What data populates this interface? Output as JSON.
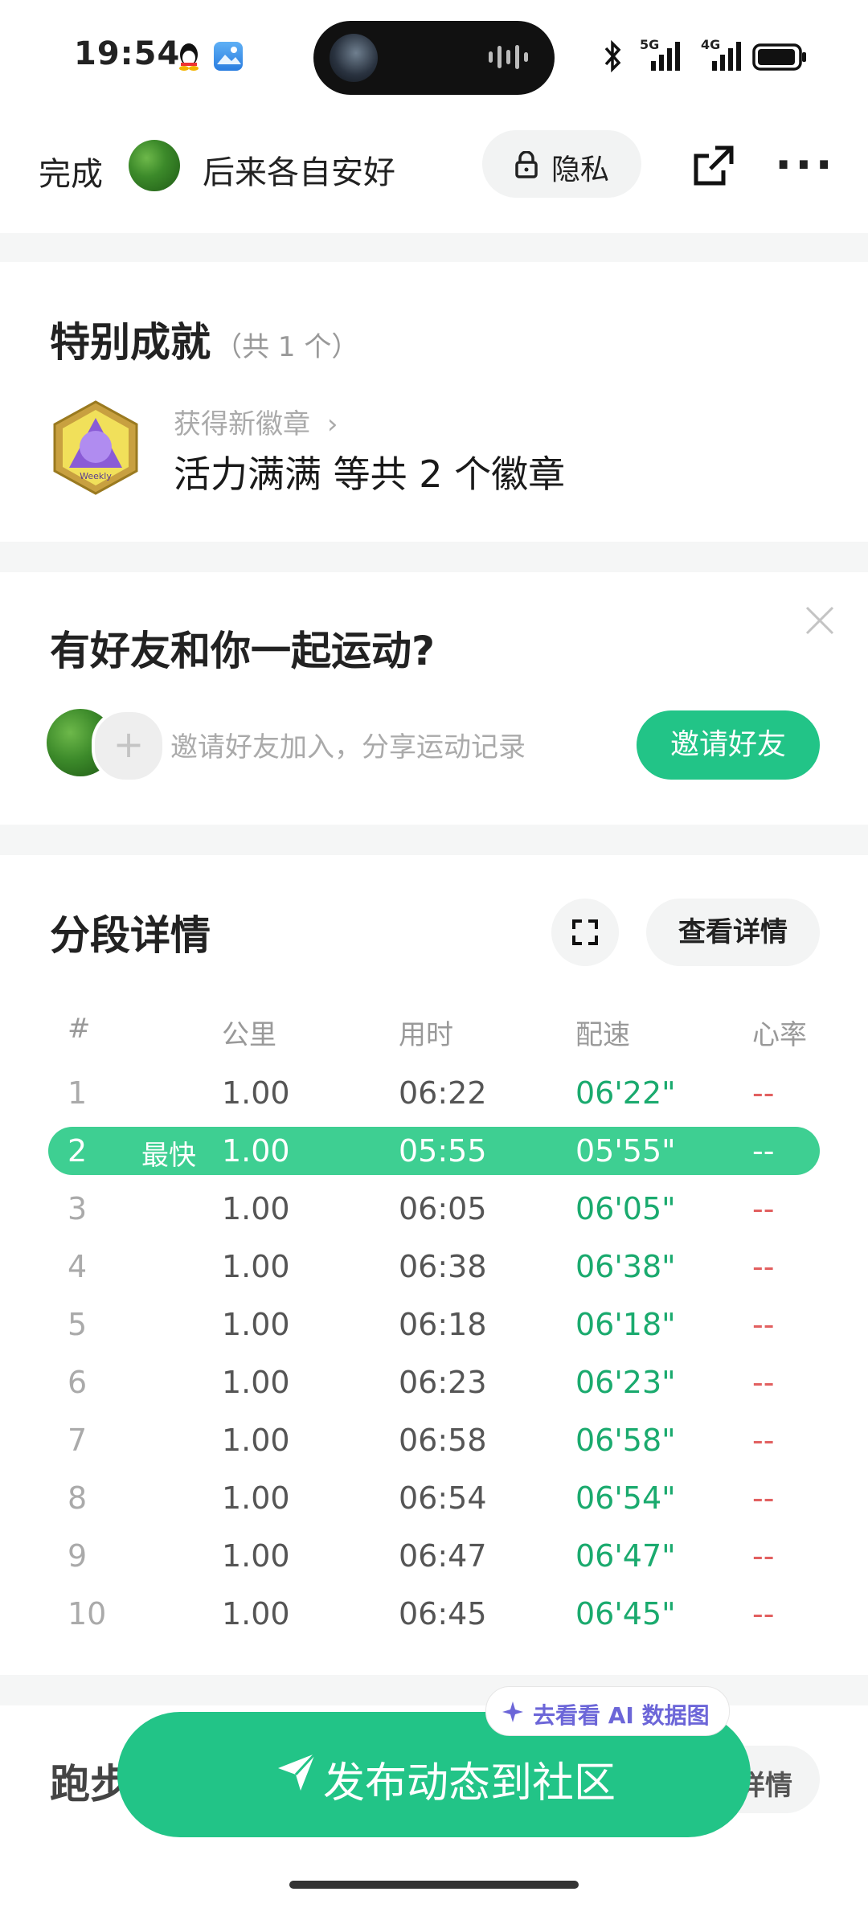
{
  "status_bar": {
    "time": "19:54",
    "net1": "5G",
    "net2": "4G"
  },
  "header": {
    "done_label": "完成",
    "user_name": "后来各自安好",
    "privacy_label": "隐私"
  },
  "achievements": {
    "title": "特别成就",
    "count_label": "（共 1 个）",
    "new_badge_label": "获得新徽章",
    "badge_summary": "活力满满 等共 2 个徽章",
    "badge_inner_text": "Weekly"
  },
  "friends": {
    "title": "有好友和你一起运动?",
    "hint": "邀请好友加入，分享运动记录",
    "invite_button": "邀请好友"
  },
  "splits": {
    "title": "分段详情",
    "view_details_button": "查看详情",
    "columns": [
      "#",
      "公里",
      "用时",
      "配速",
      "心率"
    ],
    "fastest_tag": "最快",
    "rows": [
      {
        "idx": "1",
        "km": "1.00",
        "time": "06:22",
        "pace": "06'22\"",
        "hr": "--"
      },
      {
        "idx": "2",
        "km": "1.00",
        "time": "05:55",
        "pace": "05'55\"",
        "hr": "--"
      },
      {
        "idx": "3",
        "km": "1.00",
        "time": "06:05",
        "pace": "06'05\"",
        "hr": "--"
      },
      {
        "idx": "4",
        "km": "1.00",
        "time": "06:38",
        "pace": "06'38\"",
        "hr": "--"
      },
      {
        "idx": "5",
        "km": "1.00",
        "time": "06:18",
        "pace": "06'18\"",
        "hr": "--"
      },
      {
        "idx": "6",
        "km": "1.00",
        "time": "06:23",
        "pace": "06'23\"",
        "hr": "--"
      },
      {
        "idx": "7",
        "km": "1.00",
        "time": "06:58",
        "pace": "06'58\"",
        "hr": "--"
      },
      {
        "idx": "8",
        "km": "1.00",
        "time": "06:54",
        "pace": "06'54\"",
        "hr": "--"
      },
      {
        "idx": "9",
        "km": "1.00",
        "time": "06:47",
        "pace": "06'47\"",
        "hr": "--"
      },
      {
        "idx": "10",
        "km": "1.00",
        "time": "06:45",
        "pace": "06'45\"",
        "hr": "--"
      }
    ]
  },
  "next_section": {
    "title_partial": "跑步",
    "button_partial": "详情"
  },
  "ai_tip": "去看看 AI 数据图",
  "publish_button": "发布动态到社区",
  "colors": {
    "accent": "#22c487",
    "pace": "#1aaa6e",
    "heart_rate": "#e26060",
    "ai": "#6c66d8"
  }
}
